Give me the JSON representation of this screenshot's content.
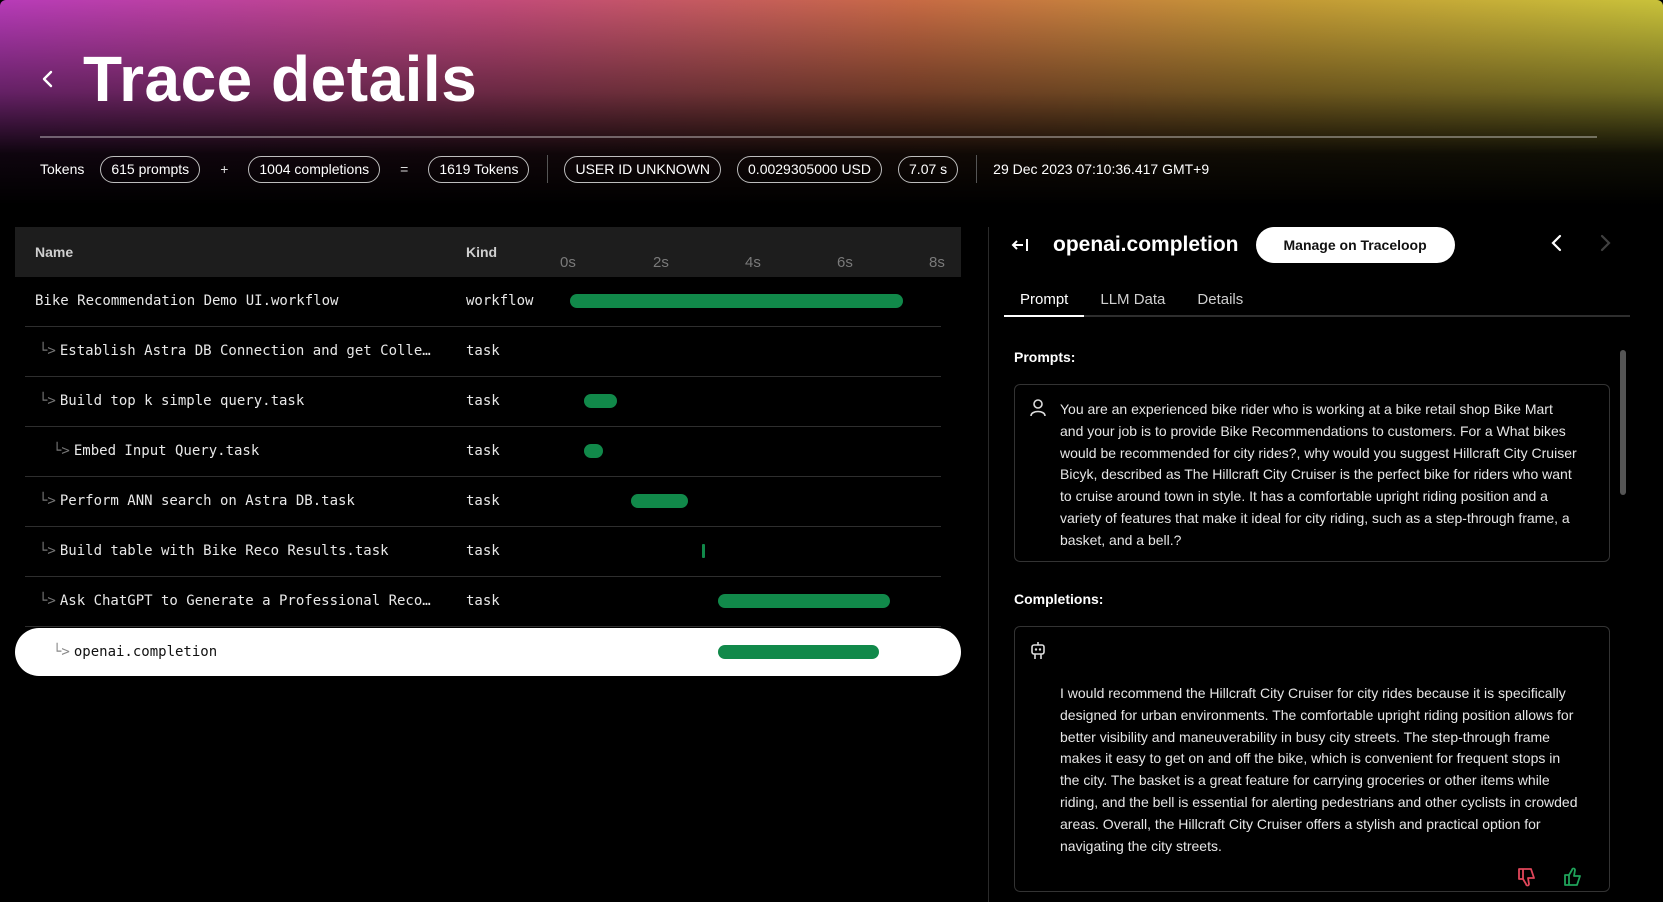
{
  "header": {
    "title": "Trace details"
  },
  "stats": {
    "tokens_label": "Tokens",
    "prompts": "615 prompts",
    "plus": "+",
    "completions": "1004 completions",
    "equals": "=",
    "total": "1619 Tokens",
    "user": "USER ID UNKNOWN",
    "cost": "0.0029305000 USD",
    "duration": "7.07 s",
    "timestamp": "29 Dec 2023 07:10:36.417 GMT+9"
  },
  "table": {
    "col_name": "Name",
    "col_kind": "Kind",
    "ticks": [
      "0s",
      "2s",
      "4s",
      "6s",
      "8s"
    ],
    "timeline_max_s": 8,
    "rows": [
      {
        "name": "Bike Recommendation Demo UI.workflow",
        "kind": "workflow",
        "prefix": "",
        "start_s": 0.0,
        "end_s": 7.07
      },
      {
        "name": "Establish Astra DB Connection and get Colle…",
        "kind": "task",
        "prefix": "└>",
        "start_s": null,
        "end_s": null
      },
      {
        "name": "Build top k simple query.task",
        "kind": "task",
        "prefix": "└>",
        "start_s": 0.3,
        "end_s": 1.0
      },
      {
        "name": "Embed Input Query.task",
        "kind": "task",
        "prefix": "└>",
        "start_s": 0.3,
        "end_s": 0.7
      },
      {
        "name": "Perform ANN search on Astra DB.task",
        "kind": "task",
        "prefix": "└>",
        "start_s": 1.3,
        "end_s": 2.5
      },
      {
        "name": "Build table with Bike Reco Results.task",
        "kind": "task",
        "prefix": "└>",
        "start_s": 2.8,
        "end_s": 2.85
      },
      {
        "name": "Ask ChatGPT to Generate a Professional Reco…",
        "kind": "task",
        "prefix": "└>",
        "start_s": 3.15,
        "end_s": 6.8
      },
      {
        "name": "openai.completion",
        "kind": "",
        "prefix": "└>",
        "start_s": 3.15,
        "end_s": 6.55,
        "selected": true
      }
    ]
  },
  "panel": {
    "span_title": "openai.completion",
    "manage_label": "Manage on Traceloop",
    "tabs": [
      "Prompt",
      "LLM Data",
      "Details"
    ],
    "prompts_label": "Prompts:",
    "prompt_text": "You are an experienced bike rider who is working at a bike retail shop Bike Mart and your job is to provide Bike Recommendations to customers. For a What bikes would be recommended for city rides?, why would you suggest Hillcraft City Cruiser Bicyk, described as The Hillcraft City Cruiser is the perfect bike for riders who want to cruise around town in style. It has a comfortable upright riding position and a variety of features that make it ideal for city riding, such as a step-through frame, a basket, and a bell.?",
    "completions_label": "Completions:",
    "completion_text": "I would recommend the Hillcraft City Cruiser for city rides because it is specifically designed for urban environments. The comfortable upright riding position allows for better visibility and maneuverability in busy city streets. The step-through frame makes it easy to get on and off the bike, which is convenient for frequent stops in the city. The basket is a great feature for carrying groceries or other items while riding, and the bell is essential for alerting pedestrians and other cyclists in crowded areas. Overall, the Hillcraft City Cruiser offers a stylish and practical option for navigating the city streets.",
    "icons": {
      "prompt": "user-icon",
      "completion": "robot-icon",
      "dislike": "thumbs-down-icon",
      "like": "thumbs-up-icon"
    }
  },
  "colors": {
    "bar": "#11894a",
    "dislike": "#e0465a",
    "like": "#1fa35a"
  }
}
